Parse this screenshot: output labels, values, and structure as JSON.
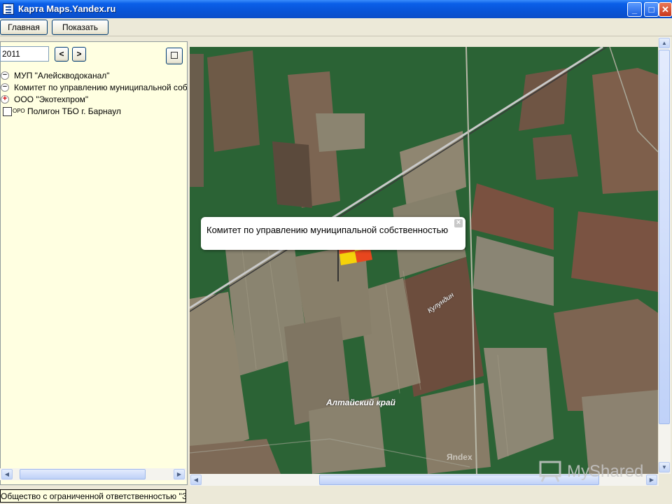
{
  "window": {
    "title": "Карта Maps.Yandex.ru",
    "minimize": "_",
    "maximize": "□",
    "close": "✕"
  },
  "toolbar": {
    "main_label": "Главная",
    "show_label": "Показать"
  },
  "filter": {
    "year": "2011",
    "prev": "<",
    "next": ">"
  },
  "tree": {
    "items": [
      {
        "label": "МУП \"Алейскводоканал\"",
        "expander": "−"
      },
      {
        "label": "Комитет по управлению муниципальной собственностью",
        "expander": "−"
      },
      {
        "label": "ООО \"Экотехпром\"",
        "expander": "+"
      },
      {
        "label": "Полигон ТБО г. Барнаул",
        "tag": "ОРО"
      }
    ]
  },
  "map": {
    "callout_text": "Комитет по управлению муниципальной собственностью",
    "callout_close": "×",
    "region_label": "Алтайский край",
    "road_label": "Кулундин",
    "provider_mark": "Яndex"
  },
  "watermark": "MyShared",
  "status": {
    "text": "Общество с ограниченной ответственностью \"Экотехпром\""
  },
  "colors": {
    "titlebar": "#0a5fe8",
    "panel_bg": "#ffffe1",
    "flag_red": "#e8461e",
    "flag_yellow": "#f5d20a"
  }
}
